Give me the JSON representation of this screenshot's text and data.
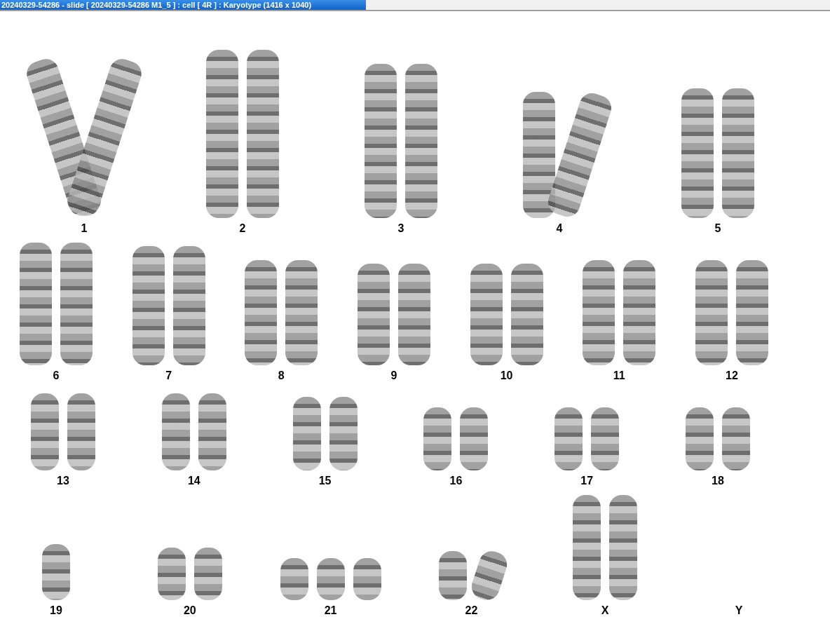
{
  "window": {
    "title": "20240329-54286 - slide [ 20240329-54286 M1_5 ] : cell [ 4R ] : Karyotype  (1416 x 1040)"
  },
  "karyogram": {
    "rows": [
      {
        "groups": [
          {
            "label": "1",
            "homologs": [
              {
                "kind": "bent"
              },
              {
                "kind": "bent"
              }
            ]
          },
          {
            "label": "2",
            "homologs": [
              {
                "kind": "straight"
              },
              {
                "kind": "straight"
              }
            ]
          },
          {
            "label": "3",
            "homologs": [
              {
                "kind": "straight"
              },
              {
                "kind": "straight"
              }
            ]
          },
          {
            "label": "4",
            "homologs": [
              {
                "kind": "straight"
              },
              {
                "kind": "bent"
              }
            ]
          },
          {
            "label": "5",
            "homologs": [
              {
                "kind": "straight"
              },
              {
                "kind": "straight"
              }
            ]
          }
        ]
      },
      {
        "groups": [
          {
            "label": "6",
            "homologs": [
              {
                "kind": "straight"
              },
              {
                "kind": "straight"
              }
            ]
          },
          {
            "label": "7",
            "homologs": [
              {
                "kind": "straight"
              },
              {
                "kind": "straight"
              }
            ]
          },
          {
            "label": "8",
            "homologs": [
              {
                "kind": "straight"
              },
              {
                "kind": "straight"
              }
            ]
          },
          {
            "label": "9",
            "homologs": [
              {
                "kind": "straight"
              },
              {
                "kind": "straight"
              }
            ]
          },
          {
            "label": "10",
            "homologs": [
              {
                "kind": "straight"
              },
              {
                "kind": "straight"
              }
            ]
          },
          {
            "label": "11",
            "homologs": [
              {
                "kind": "straight"
              },
              {
                "kind": "straight"
              }
            ]
          },
          {
            "label": "12",
            "homologs": [
              {
                "kind": "straight"
              },
              {
                "kind": "straight"
              }
            ]
          }
        ]
      },
      {
        "groups": [
          {
            "label": "13",
            "homologs": [
              {
                "kind": "straight"
              },
              {
                "kind": "straight"
              }
            ]
          },
          {
            "label": "14",
            "homologs": [
              {
                "kind": "straight"
              },
              {
                "kind": "straight"
              }
            ]
          },
          {
            "label": "15",
            "homologs": [
              {
                "kind": "straight"
              },
              {
                "kind": "straight"
              }
            ]
          },
          {
            "label": "16",
            "homologs": [
              {
                "kind": "straight"
              },
              {
                "kind": "straight"
              }
            ]
          },
          {
            "label": "17",
            "homologs": [
              {
                "kind": "straight"
              },
              {
                "kind": "straight"
              }
            ]
          },
          {
            "label": "18",
            "homologs": [
              {
                "kind": "straight"
              },
              {
                "kind": "straight"
              }
            ]
          }
        ]
      },
      {
        "groups": [
          {
            "label": "19",
            "homologs": [
              {
                "kind": "straight"
              }
            ]
          },
          {
            "label": "20",
            "homologs": [
              {
                "kind": "straight"
              },
              {
                "kind": "straight"
              }
            ]
          },
          {
            "label": "21",
            "homologs": [
              {
                "kind": "straight"
              },
              {
                "kind": "straight"
              },
              {
                "kind": "straight"
              }
            ]
          },
          {
            "label": "22",
            "homologs": [
              {
                "kind": "straight"
              },
              {
                "kind": "bent"
              }
            ]
          },
          {
            "label": "X",
            "homologs": [
              {
                "kind": "straight"
              },
              {
                "kind": "straight"
              }
            ]
          },
          {
            "label": "Y"
          }
        ]
      }
    ]
  }
}
